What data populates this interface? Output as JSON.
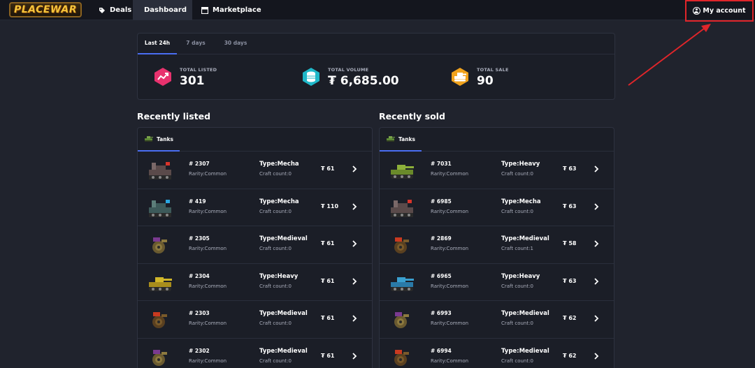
{
  "brand": {
    "logo_text": "PLACEWAR"
  },
  "nav": {
    "items": [
      {
        "label": "Deals",
        "icon": "tag-icon"
      },
      {
        "label": "Dashboard",
        "icon": "dashboard-icon",
        "active": true
      },
      {
        "label": "Marketplace",
        "icon": "marketplace-icon"
      }
    ],
    "account_label": "My account"
  },
  "stats": {
    "tabs": [
      {
        "label": "Last 24h",
        "active": true
      },
      {
        "label": "7 days"
      },
      {
        "label": "30 days"
      }
    ],
    "items": [
      {
        "label": "TOTAL LISTED",
        "value": "301",
        "icon": "trend-chart-icon",
        "color": "#e8326e"
      },
      {
        "label": "TOTAL VOLUME",
        "value": "₮ 6,685.00",
        "icon": "coin-stack-icon",
        "color": "#1fb8c9"
      },
      {
        "label": "TOTAL SALE",
        "value": "90",
        "icon": "tank-icon",
        "color": "#f0a21c"
      }
    ]
  },
  "recently_listed": {
    "title": "Recently listed",
    "tab": "Tanks",
    "rows": [
      {
        "id": "# 2307",
        "rarity": "Rarity:Common",
        "type": "Type:Mecha",
        "craft": "Craft count:0",
        "price": "₮ 61",
        "tank": "mecha-red"
      },
      {
        "id": "# 419",
        "rarity": "Rarity:Common",
        "type": "Type:Mecha",
        "craft": "Craft count:0",
        "price": "₮ 110",
        "tank": "mecha-blue"
      },
      {
        "id": "# 2305",
        "rarity": "Rarity:Common",
        "type": "Type:Medieval",
        "craft": "Craft count:0",
        "price": "₮ 61",
        "tank": "medieval-purple"
      },
      {
        "id": "# 2304",
        "rarity": "Rarity:Common",
        "type": "Type:Heavy",
        "craft": "Craft count:0",
        "price": "₮ 61",
        "tank": "heavy-yellow"
      },
      {
        "id": "# 2303",
        "rarity": "Rarity:Common",
        "type": "Type:Medieval",
        "craft": "Craft count:0",
        "price": "₮ 61",
        "tank": "medieval-brown"
      },
      {
        "id": "# 2302",
        "rarity": "Rarity:Common",
        "type": "Type:Medieval",
        "craft": "Craft count:0",
        "price": "₮ 61",
        "tank": "medieval-purple"
      }
    ]
  },
  "recently_sold": {
    "title": "Recently sold",
    "tab": "Tanks",
    "rows": [
      {
        "id": "# 7031",
        "rarity": "Rarity:Common",
        "type": "Type:Heavy",
        "craft": "Craft count:0",
        "price": "₮ 63",
        "tank": "heavy-green"
      },
      {
        "id": "# 6985",
        "rarity": "Rarity:Common",
        "type": "Type:Mecha",
        "craft": "Craft count:0",
        "price": "₮ 63",
        "tank": "mecha-red"
      },
      {
        "id": "# 2869",
        "rarity": "Rarity:Common",
        "type": "Type:Medieval",
        "craft": "Craft count:1",
        "price": "₮ 58",
        "tank": "medieval-brown"
      },
      {
        "id": "# 6965",
        "rarity": "Rarity:Common",
        "type": "Type:Heavy",
        "craft": "Craft count:0",
        "price": "₮ 63",
        "tank": "heavy-blue"
      },
      {
        "id": "# 6993",
        "rarity": "Rarity:Common",
        "type": "Type:Medieval",
        "craft": "Craft count:0",
        "price": "₮ 62",
        "tank": "medieval-purple"
      },
      {
        "id": "# 6994",
        "rarity": "Rarity:Common",
        "type": "Type:Medieval",
        "craft": "Craft count:0",
        "price": "₮ 62",
        "tank": "medieval-brown"
      }
    ]
  }
}
